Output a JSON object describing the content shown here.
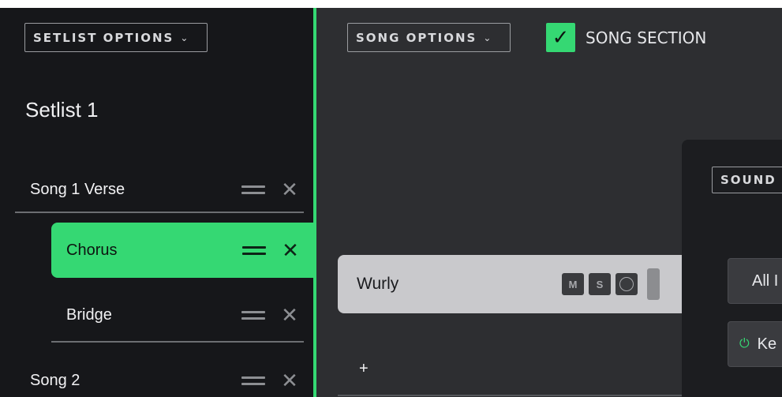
{
  "setlist_options": {
    "label": "SETLIST OPTIONS",
    "icon": "chevron-down-icon"
  },
  "setlist": {
    "title": "Setlist 1",
    "items": [
      {
        "label": "Song 1 Verse",
        "active": false
      },
      {
        "label": "Chorus",
        "active": true
      },
      {
        "label": "Bridge",
        "active": false
      },
      {
        "label": "Song 2",
        "active": false
      }
    ]
  },
  "song_options": {
    "label": "SONG OPTIONS",
    "icon": "chevron-down-icon"
  },
  "song_section": {
    "label": "SONG SECTION",
    "checked": true
  },
  "track": {
    "name": "Wurly",
    "mute_label": "M",
    "solo_label": "S"
  },
  "add_track": {
    "label": "+"
  },
  "sound_options": {
    "label": "SOUND"
  },
  "sound_presets": {
    "all_label": "All I",
    "ke_label": "Ke"
  },
  "colors": {
    "accent": "#35d873",
    "panel": "#16171a",
    "background": "#2d2e31"
  }
}
